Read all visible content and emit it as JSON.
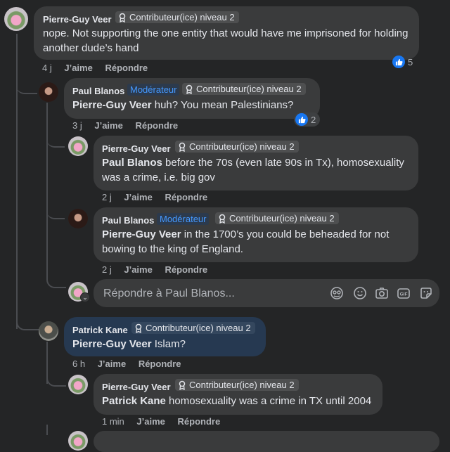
{
  "labels": {
    "like": "J’aime",
    "reply": "Répondre",
    "moderator": "Modérateur",
    "contributor": "Contributeur(ice) niveau 2"
  },
  "comments": [
    {
      "author": "Pierre-Guy Veer",
      "text": "nope. Not supporting the one entity that would have me imprisoned for holding another dude’s hand",
      "time": "4 j",
      "reactions": "5"
    },
    {
      "author": "Paul Blanos",
      "mention": "Pierre-Guy Veer",
      "text": " huh? You mean Palestinians?",
      "time": "3 j",
      "reactions": "2"
    },
    {
      "author": "Pierre-Guy Veer",
      "mention": "Paul Blanos",
      "text": " before the 70s (even late 90s in Tx), homosexuality was a crime, i.e. big gov",
      "time": "2 j"
    },
    {
      "author": "Paul Blanos",
      "mention": "Pierre-Guy Veer",
      "text": " in the 1700’s you could be beheaded for not bowing to the king of England.",
      "time": "2 j"
    },
    {
      "author": "Patrick Kane",
      "mention": "Pierre-Guy Veer",
      "text": " Islam?",
      "time": "6 h"
    },
    {
      "author": "Pierre-Guy Veer",
      "mention": "Patrick Kane",
      "text": " homosexuality was a crime in TX until 2004",
      "time": "1 min"
    }
  ],
  "reply_box": {
    "placeholder": "Répondre à Paul Blanos..."
  },
  "colors": {
    "background": "#242526",
    "bubble": "#3a3b3c",
    "highlight_bubble": "#263951",
    "link_blue": "#4599ff",
    "like_blue": "#1877f2"
  },
  "icons": [
    "award-icon",
    "like-icon",
    "avatar-sticker-icon",
    "emoji-icon",
    "camera-icon",
    "gif-icon",
    "sticker-icon"
  ]
}
